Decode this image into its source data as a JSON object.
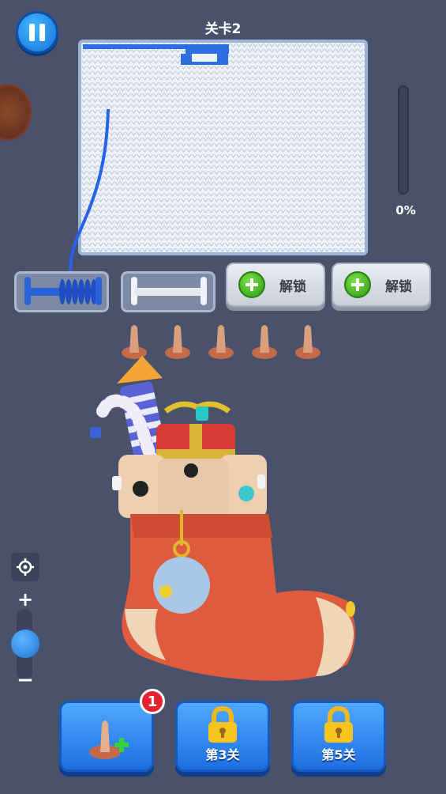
{
  "header": {
    "level_title": "关卡2"
  },
  "progress": {
    "percent_label": "0%",
    "value": 0
  },
  "spools": [
    {
      "label": "解锁"
    },
    {
      "label": "解锁"
    }
  ],
  "booster_buttons": [
    {
      "badge": "1"
    },
    {
      "label": "第3关"
    },
    {
      "label": "第5关"
    }
  ],
  "zoom": {
    "plus": "+",
    "minus": "−"
  },
  "colors": {
    "yarn_blue": "#2563e8",
    "button_blue": "#1d6fe0",
    "background": "#4a526b"
  }
}
